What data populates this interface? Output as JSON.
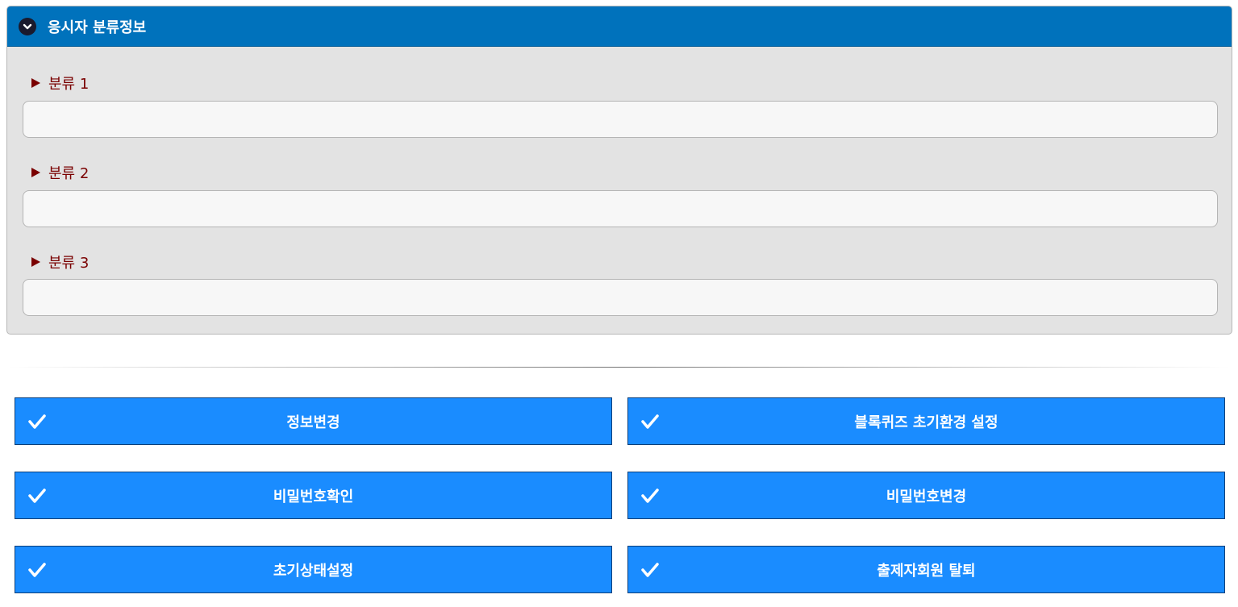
{
  "panel": {
    "title": "응시자 분류정보",
    "icon": "chevron-down-circle-icon",
    "header_color": "#0072bc",
    "fields": [
      {
        "label": "분류 1",
        "value": ""
      },
      {
        "label": "분류 2",
        "value": ""
      },
      {
        "label": "분류 3",
        "value": ""
      }
    ]
  },
  "actions": {
    "button_color": "#1a8cff",
    "icon": "checkmark-icon",
    "info_change": "정보변경",
    "blockquiz_settings": "블록퀴즈 초기환경 설정",
    "password_confirm": "비밀번호확인",
    "password_change": "비밀번호변경",
    "reset_state": "초기상태설정",
    "withdraw_member": "출제자회원 탈퇴"
  }
}
